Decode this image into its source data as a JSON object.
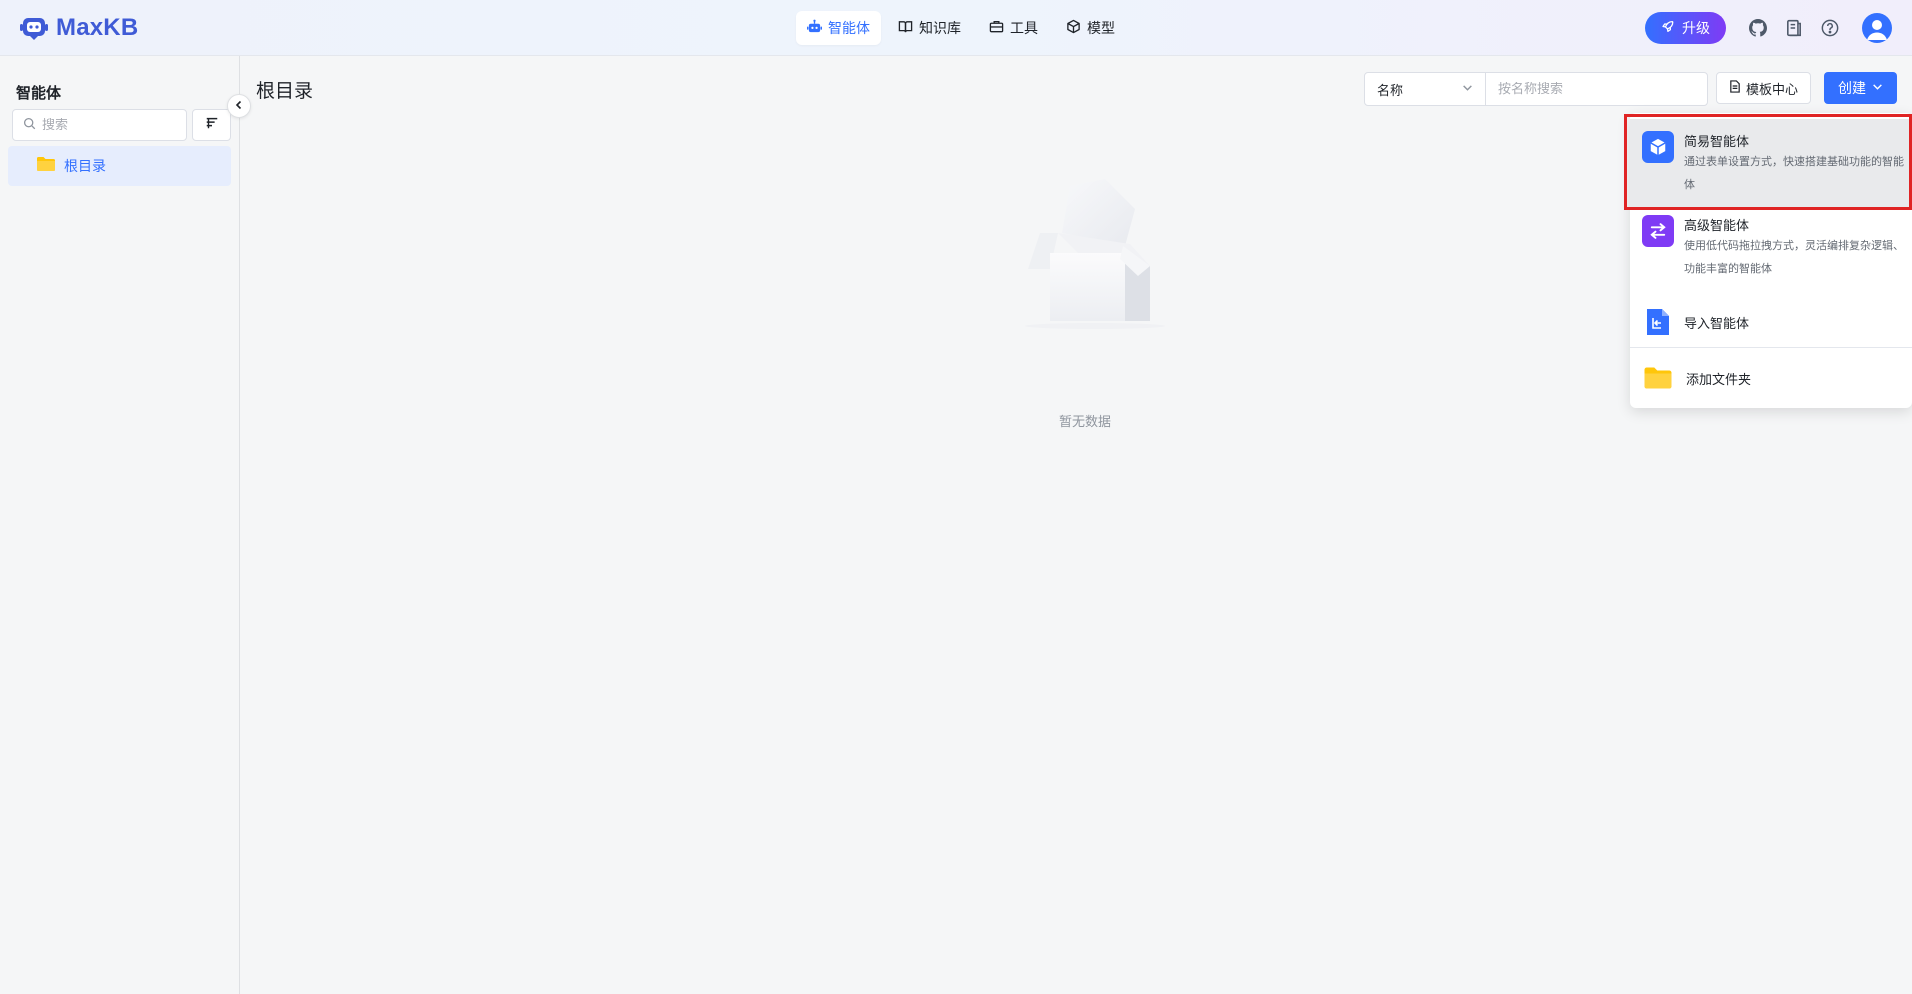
{
  "header": {
    "logo_text": "MaxKB",
    "nav": [
      {
        "label": "智能体",
        "icon": "robot-icon",
        "active": true
      },
      {
        "label": "知识库",
        "icon": "book-open-icon",
        "active": false
      },
      {
        "label": "工具",
        "icon": "toolbox-icon",
        "active": false
      },
      {
        "label": "模型",
        "icon": "cube-icon",
        "active": false
      }
    ],
    "upgrade_label": "升级",
    "accent": "#3370ff"
  },
  "sidebar": {
    "title": "智能体",
    "search_placeholder": "搜索",
    "tree": [
      {
        "label": "根目录",
        "icon": "folder-icon",
        "selected": true
      }
    ]
  },
  "main": {
    "title": "根目录",
    "filter": {
      "field": "名称",
      "placeholder": "按名称搜索"
    },
    "template_center_label": "模板中心",
    "create_label": "创建",
    "empty_text": "暂无数据"
  },
  "create_menu": {
    "items": [
      {
        "title": "简易智能体",
        "desc": "通过表单设置方式，快速搭建基础功能的智能体",
        "icon": "cube-icon",
        "color": "#3370ff",
        "highlighted": true
      },
      {
        "title": "高级智能体",
        "desc": "使用低代码拖拉拽方式，灵活编排复杂逻辑、功能丰富的智能体",
        "icon": "workflow-icon",
        "color": "#7f3bf5",
        "highlighted": false
      },
      {
        "title": "导入智能体",
        "desc": "",
        "icon": "import-file-icon",
        "color": "#3370ff",
        "highlighted": false
      },
      {
        "title": "添加文件夹",
        "desc": "",
        "icon": "folder-icon",
        "color": "#ffc60a",
        "highlighted": false
      }
    ]
  }
}
